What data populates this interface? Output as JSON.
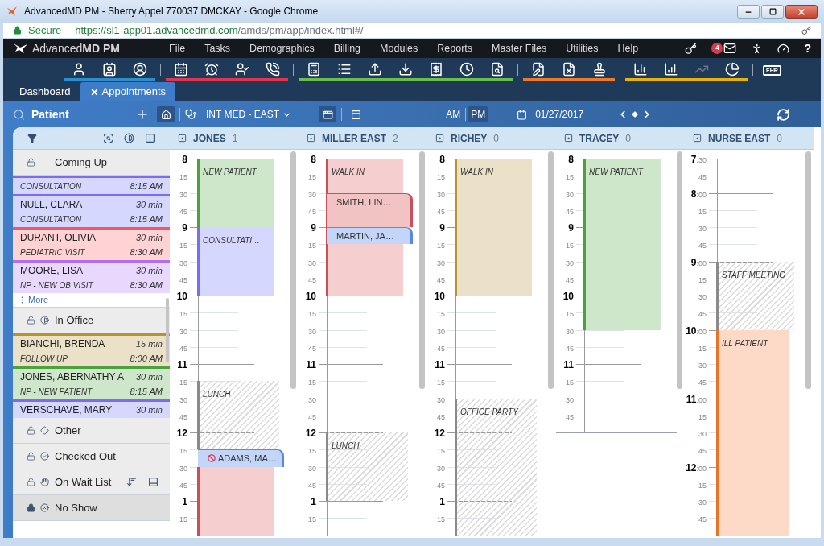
{
  "browser": {
    "title": "AdvancedMD PM - Sherry Appel 770037 DMCKAY - Google Chrome",
    "secure_label": "Secure",
    "url_host": "https://sl1-app01.advancedmd.com",
    "url_path": "/amds/pm/app/index.html#/"
  },
  "app": {
    "logo": "Advanced**MD PM**",
    "menu": [
      "File",
      "Tasks",
      "Demographics",
      "Billing",
      "Modules",
      "Reports",
      "Master Files",
      "Utilities",
      "Help"
    ],
    "notification_count": "4",
    "help": "?"
  },
  "toolbar": {
    "groups": [
      {
        "color": "#2a8fd0",
        "buttons": [
          {
            "disabled": false
          },
          {
            "disabled": false
          },
          {
            "disabled": false
          }
        ]
      },
      {
        "color": "#e2354f",
        "buttons": [
          {
            "disabled": false
          },
          {
            "disabled": false
          },
          {
            "disabled": false
          },
          {
            "disabled": false
          }
        ]
      },
      {
        "color": "#6abf4b",
        "buttons": [
          {
            "disabled": false
          },
          {
            "disabled": false
          },
          {
            "disabled": false
          },
          {
            "disabled": false
          },
          {
            "disabled": false
          },
          {
            "disabled": false
          },
          {
            "disabled": false
          }
        ]
      },
      {
        "color": "#f07a22",
        "buttons": [
          {
            "disabled": false
          },
          {
            "disabled": false
          },
          {
            "disabled": false
          }
        ]
      },
      {
        "color": "#e8b400",
        "buttons": [
          {
            "disabled": false
          },
          {
            "disabled": false
          },
          {
            "disabled": true
          },
          {
            "disabled": false
          }
        ]
      }
    ],
    "ehr": "EHR"
  },
  "tabs": [
    {
      "label": "Dashboard",
      "selected": false,
      "closable": false
    },
    {
      "label": "Appointments",
      "selected": true,
      "closable": true
    }
  ],
  "filter_bar": {
    "title": "Patient",
    "home_selected": true,
    "location": "INT MED - EAST",
    "views": [
      {
        "selected": true
      },
      {
        "selected": false
      }
    ],
    "periods": [
      {
        "label": "AM",
        "selected": false
      },
      {
        "label": "PM",
        "selected": true
      }
    ],
    "date": "01/27/2017"
  },
  "sidebar": {
    "sections": [
      {
        "kind": "coming_up",
        "label": "Coming Up",
        "locked": false,
        "appointments": [
          {
            "type": "CONSULTATION",
            "time": "8:15 AM",
            "color": "#7b6cf0"
          },
          {
            "name": "NULL, CLARA",
            "duration": "30 min",
            "type": "CONSULTATION",
            "time": "8:15 AM",
            "color": "#7b6cf0"
          },
          {
            "name": "DURANT, OLIVIA",
            "duration": "30 min",
            "type": "PEDIATRIC VISIT",
            "time": "8:30 AM",
            "color": "#f0586a"
          },
          {
            "name": "MOORE, LISA",
            "duration": "30 min",
            "type": "NP - NEW OB VISIT",
            "time": "8:30 AM",
            "color": "#b06ff0"
          }
        ],
        "more": "More"
      },
      {
        "kind": "in_office",
        "label": "In Office",
        "locked": false,
        "appointments": [
          {
            "name": "BIANCHI, BRENDA",
            "duration": "15 min",
            "type": "FOLLOW UP",
            "time": "8:00 AM",
            "color": "#b8932a"
          },
          {
            "name": "JONES, ABERNATHY A",
            "duration": "30 min",
            "type": "NP - NEW PATIENT",
            "time": "8:15 AM",
            "color": "#4aa33a"
          },
          {
            "name": "VERSCHAVE, MARY",
            "duration": "30 min",
            "color": "#7b6cf0"
          }
        ]
      },
      {
        "kind": "other",
        "label": "Other",
        "locked": false
      },
      {
        "kind": "checked_out",
        "label": "Checked Out",
        "locked": false
      },
      {
        "kind": "wait_list",
        "label": "On Wait List",
        "locked": false
      },
      {
        "kind": "no_show",
        "label": "No Show",
        "locked": true
      }
    ]
  },
  "columns": [
    {
      "name": "JONES",
      "count": "1",
      "day_end": false,
      "timeline": [
        {
          "kind": "block",
          "label": "NEW PATIENT",
          "color": "#4aa33a",
          "items": [
            {
              "kind": "row",
              "time": "8",
              "hour": true
            },
            {
              "kind": "row",
              "time": "15",
              "hour": false
            },
            {
              "kind": "row",
              "time": "30",
              "hour": false
            },
            {
              "kind": "row",
              "time": "45",
              "hour": false
            },
            {
              "kind": "block",
              "label": "CONSULTATI…",
              "color": "#7b6cf0",
              "items": [
                {
                  "kind": "row",
                  "time": "9",
                  "hour": true
                },
                {
                  "kind": "row",
                  "time": "15",
                  "hour": false
                },
                {
                  "kind": "row",
                  "time": "30",
                  "hour": false
                },
                {
                  "kind": "row",
                  "time": "45",
                  "hour": false
                }
              ]
            }
          ]
        },
        {
          "kind": "row",
          "time": "10",
          "hour": true
        },
        {
          "kind": "row",
          "time": "15",
          "hour": false
        },
        {
          "kind": "row",
          "time": "30",
          "hour": false
        },
        {
          "kind": "row",
          "time": "45",
          "hour": false
        },
        {
          "kind": "row",
          "time": "11",
          "hour": true
        },
        {
          "kind": "blocked",
          "label": "LUNCH",
          "items": [
            {
              "kind": "row",
              "time": "15",
              "hour": false
            },
            {
              "kind": "row",
              "time": "30",
              "hour": false
            },
            {
              "kind": "row",
              "time": "45",
              "hour": false
            },
            {
              "kind": "row",
              "time": "12",
              "hour": true
            }
          ]
        },
        {
          "kind": "block",
          "color": "#c9505a",
          "items": [
            {
              "kind": "appointment",
              "label": "ADAMS, MA…",
              "flagged": true,
              "color": "#5b86e5",
              "items": [
                {
                  "kind": "row",
                  "time": "15",
                  "hour": false
                }
              ]
            },
            {
              "kind": "row",
              "time": "30",
              "hour": false
            },
            {
              "kind": "row",
              "time": "45",
              "hour": false
            },
            {
              "kind": "row",
              "time": "1",
              "hour": true
            },
            {
              "kind": "row",
              "time": "15",
              "hour": false
            }
          ]
        }
      ]
    },
    {
      "name": "MILLER EAST",
      "count": "2",
      "day_end": false,
      "timeline": [
        {
          "kind": "block",
          "label": "WALK IN",
          "color": "#c9505a",
          "items": [
            {
              "kind": "row",
              "time": "8",
              "hour": true
            },
            {
              "kind": "row",
              "time": "15",
              "hour": false
            },
            {
              "kind": "appointment",
              "label": "SMITH, LIN…",
              "flagged": false,
              "color": "#c9505a",
              "items": [
                {
                  "kind": "row",
                  "time": "30",
                  "hour": false
                },
                {
                  "kind": "row",
                  "time": "45",
                  "hour": false
                }
              ]
            },
            {
              "kind": "appointment",
              "label": "MARTIN, JA…",
              "flagged": false,
              "color": "#5b86e5",
              "items": [
                {
                  "kind": "row",
                  "time": "9",
                  "hour": true
                }
              ]
            },
            {
              "kind": "row",
              "time": "15",
              "hour": false
            },
            {
              "kind": "row",
              "time": "30",
              "hour": false
            },
            {
              "kind": "row",
              "time": "45",
              "hour": false
            }
          ]
        },
        {
          "kind": "row",
          "time": "10",
          "hour": true
        },
        {
          "kind": "row",
          "time": "15",
          "hour": false
        },
        {
          "kind": "row",
          "time": "30",
          "hour": false
        },
        {
          "kind": "row",
          "time": "45",
          "hour": false
        },
        {
          "kind": "row",
          "time": "11",
          "hour": true
        },
        {
          "kind": "row",
          "time": "15",
          "hour": false
        },
        {
          "kind": "row",
          "time": "30",
          "hour": false
        },
        {
          "kind": "row",
          "time": "45",
          "hour": false
        },
        {
          "kind": "blocked",
          "label": "LUNCH",
          "items": [
            {
              "kind": "row",
              "time": "12",
              "hour": true
            },
            {
              "kind": "row",
              "time": "15",
              "hour": false
            },
            {
              "kind": "row",
              "time": "30",
              "hour": false
            },
            {
              "kind": "row",
              "time": "45",
              "hour": false
            }
          ]
        },
        {
          "kind": "row",
          "time": "1",
          "hour": true
        },
        {
          "kind": "row",
          "time": "15",
          "hour": false
        }
      ]
    },
    {
      "name": "RICHEY",
      "count": "0",
      "day_end": false,
      "timeline": [
        {
          "kind": "block",
          "label": "WALK IN",
          "color": "#b8932a",
          "items": [
            {
              "kind": "row",
              "time": "8",
              "hour": true
            },
            {
              "kind": "row",
              "time": "15",
              "hour": false
            },
            {
              "kind": "row",
              "time": "30",
              "hour": false
            },
            {
              "kind": "row",
              "time": "45",
              "hour": false
            },
            {
              "kind": "row",
              "time": "9",
              "hour": true
            },
            {
              "kind": "row",
              "time": "15",
              "hour": false
            },
            {
              "kind": "row",
              "time": "30",
              "hour": false
            },
            {
              "kind": "row",
              "time": "45",
              "hour": false
            }
          ]
        },
        {
          "kind": "row",
          "time": "10",
          "hour": true
        },
        {
          "kind": "row",
          "time": "15",
          "hour": false
        },
        {
          "kind": "row",
          "time": "30",
          "hour": false
        },
        {
          "kind": "row",
          "time": "45",
          "hour": false
        },
        {
          "kind": "row",
          "time": "11",
          "hour": true
        },
        {
          "kind": "row",
          "time": "15",
          "hour": false
        },
        {
          "kind": "blocked",
          "label": "OFFICE PARTY",
          "items": [
            {
              "kind": "row",
              "time": "30",
              "hour": false
            },
            {
              "kind": "row",
              "time": "45",
              "hour": false
            },
            {
              "kind": "row",
              "time": "12",
              "hour": true
            },
            {
              "kind": "row",
              "time": "15",
              "hour": false
            },
            {
              "kind": "row",
              "time": "30",
              "hour": false
            },
            {
              "kind": "row",
              "time": "45",
              "hour": false
            },
            {
              "kind": "row",
              "time": "1",
              "hour": true
            },
            {
              "kind": "row",
              "time": "15",
              "hour": false
            }
          ]
        }
      ]
    },
    {
      "name": "TRACEY",
      "count": "0",
      "day_end": true,
      "timeline": [
        {
          "kind": "block",
          "label": "NEW PATIENT",
          "color": "#4aa33a",
          "items": [
            {
              "kind": "row",
              "time": "8",
              "hour": true
            },
            {
              "kind": "row",
              "time": "15",
              "hour": false
            },
            {
              "kind": "row",
              "time": "30",
              "hour": false
            },
            {
              "kind": "row",
              "time": "45",
              "hour": false
            },
            {
              "kind": "row",
              "time": "9",
              "hour": true
            },
            {
              "kind": "row",
              "time": "15",
              "hour": false
            },
            {
              "kind": "row",
              "time": "30",
              "hour": false
            },
            {
              "kind": "row",
              "time": "45",
              "hour": false
            },
            {
              "kind": "row",
              "time": "10",
              "hour": true
            },
            {
              "kind": "row",
              "time": "15",
              "hour": false
            }
          ]
        },
        {
          "kind": "row",
          "time": "30",
          "hour": false
        },
        {
          "kind": "row",
          "time": "45",
          "hour": false
        },
        {
          "kind": "row",
          "time": "11",
          "hour": true
        },
        {
          "kind": "row",
          "time": "15",
          "hour": false
        },
        {
          "kind": "row",
          "time": "30",
          "hour": false
        },
        {
          "kind": "row",
          "time": "45",
          "hour": false
        }
      ]
    },
    {
      "name": "NURSE EAST",
      "count": "0",
      "day_end": false,
      "timeline": [
        {
          "kind": "row",
          "time": "7",
          "suffix": ":30",
          "hour": true
        },
        {
          "kind": "row",
          "time": "45",
          "hour": false
        },
        {
          "kind": "row",
          "time": "8",
          "suffix": ":00",
          "hour": true
        },
        {
          "kind": "row",
          "time": "15",
          "hour": false
        },
        {
          "kind": "row",
          "time": "30",
          "hour": false
        },
        {
          "kind": "row",
          "time": "45",
          "hour": false
        },
        {
          "kind": "blocked",
          "label": "STAFF MEETING",
          "items": [
            {
              "kind": "row",
              "time": "9",
              "suffix": ":00",
              "hour": true
            },
            {
              "kind": "row",
              "time": "15",
              "hour": false
            },
            {
              "kind": "row",
              "time": "30",
              "hour": false
            },
            {
              "kind": "row",
              "time": "45",
              "hour": false
            }
          ]
        },
        {
          "kind": "block",
          "label": "ILL PATIENT",
          "color": "#e8742a",
          "items": [
            {
              "kind": "row",
              "time": "10",
              "suffix": ":00",
              "hour": true
            },
            {
              "kind": "row",
              "time": "15",
              "hour": false
            },
            {
              "kind": "row",
              "time": "30",
              "hour": false
            },
            {
              "kind": "row",
              "time": "45",
              "hour": false
            },
            {
              "kind": "row",
              "time": "11",
              "suffix": ":00",
              "hour": true
            },
            {
              "kind": "row",
              "time": "15",
              "hour": false
            },
            {
              "kind": "row",
              "time": "30",
              "hour": false
            },
            {
              "kind": "row",
              "time": "45",
              "hour": false
            },
            {
              "kind": "row",
              "time": "12",
              "suffix": ":00",
              "hour": true
            },
            {
              "kind": "row",
              "time": "15",
              "hour": false
            },
            {
              "kind": "row",
              "time": "30",
              "hour": false
            },
            {
              "kind": "row",
              "time": "45",
              "hour": false
            }
          ]
        }
      ]
    }
  ]
}
